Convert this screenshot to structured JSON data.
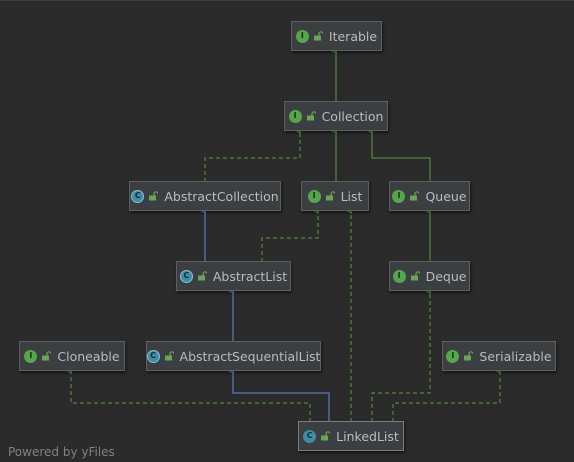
{
  "watermark": "Powered by yFiles",
  "colors": {
    "background": "#2b2b2b",
    "node_fill": "#3c3f41",
    "node_border": "#5e6060",
    "text": "#bbbbbb",
    "implements_edge": "#5f9a4b",
    "extends_edge": "#5d8fd8",
    "interface_badge": "#56a64e",
    "class_badge": "#3f8ca8"
  },
  "nodes": {
    "iterable": {
      "label": "Iterable",
      "kind_letter": "I",
      "kind": "interface",
      "icon": "lock-open-icon"
    },
    "collection": {
      "label": "Collection",
      "kind_letter": "I",
      "kind": "interface",
      "icon": "lock-open-icon"
    },
    "abstract_collection": {
      "label": "AbstractCollection",
      "kind_letter": "C",
      "kind": "abstract-class",
      "icon": "lock-open-icon"
    },
    "list": {
      "label": "List",
      "kind_letter": "I",
      "kind": "interface",
      "icon": "lock-open-icon"
    },
    "queue": {
      "label": "Queue",
      "kind_letter": "I",
      "kind": "interface",
      "icon": "lock-open-icon"
    },
    "abstract_list": {
      "label": "AbstractList",
      "kind_letter": "C",
      "kind": "abstract-class",
      "icon": "lock-open-icon"
    },
    "deque": {
      "label": "Deque",
      "kind_letter": "I",
      "kind": "interface",
      "icon": "lock-open-icon"
    },
    "cloneable": {
      "label": "Cloneable",
      "kind_letter": "I",
      "kind": "interface",
      "icon": "lock-open-icon"
    },
    "abstract_sequential": {
      "label": "AbstractSequentialList",
      "kind_letter": "C",
      "kind": "abstract-class",
      "icon": "lock-open-icon"
    },
    "serializable": {
      "label": "Serializable",
      "kind_letter": "I",
      "kind": "interface",
      "icon": "lock-open-icon"
    },
    "linked_list": {
      "label": "LinkedList",
      "kind_letter": "C",
      "kind": "class",
      "icon": "lock-open-icon"
    }
  }
}
